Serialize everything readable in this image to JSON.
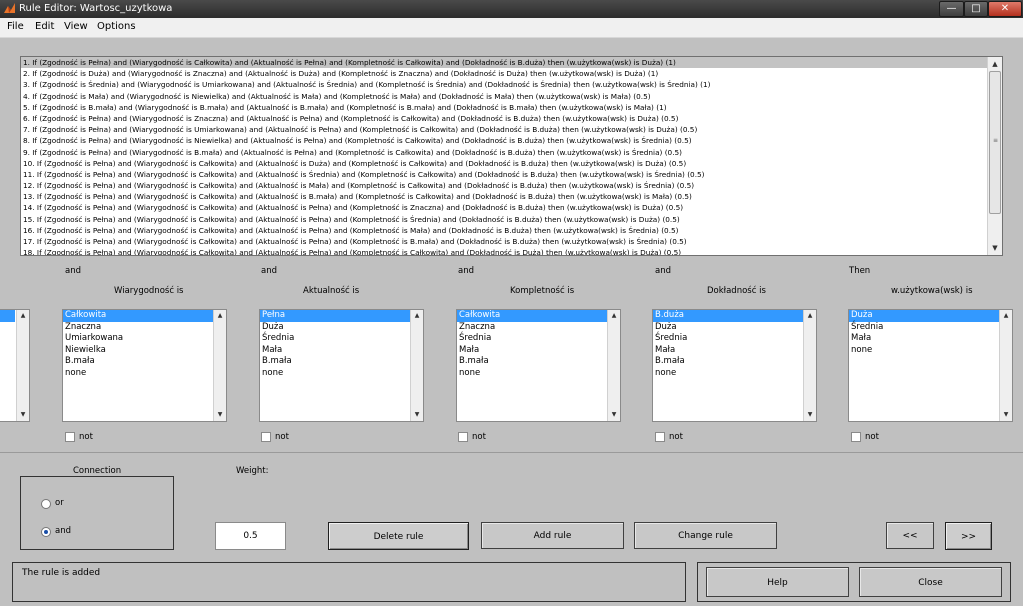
{
  "window": {
    "title": "Rule Editor: Wartosc_uzytkowa",
    "minimize": "—",
    "maximize": "□",
    "close": "✕"
  },
  "menu": [
    "File",
    "Edit",
    "View",
    "Options"
  ],
  "rules": [
    "1. If (Zgodność is Pełna) and (Wiarygodność is Całkowita) and (Aktualność is Pełna) and (Kompletność is Całkowita) and (Dokładność is B.duża) then (w.użytkowa(wsk) is Duża) (1)",
    "2. If (Zgodność is Duża) and (Wiarygodność is Znaczna) and (Aktualność is Duża) and (Kompletność is Znaczna) and (Dokładność is Duża) then (w.użytkowa(wsk) is Duża) (1)",
    "3. If (Zgodność is Średnia) and (Wiarygodność is Umiarkowana) and (Aktualność is Średnia) and (Kompletność is Średnia) and (Dokładność is Średnia) then (w.użytkowa(wsk) is Średnia) (1)",
    "4. If (Zgodność is Mała) and (Wiarygodność is Niewielka) and (Aktualność is Mała) and (Kompletność is Mała) and (Dokładność is Mała) then (w.użytkowa(wsk) is Mała) (0.5)",
    "5. If (Zgodność is B.mała) and (Wiarygodność is B.mała) and (Aktualność is B.mała) and (Kompletność is B.mała) and (Dokładność is B.mała) then (w.użytkowa(wsk) is Mała) (1)",
    "6. If (Zgodność is Pełna) and (Wiarygodność is Znaczna) and (Aktualność is Pełna) and (Kompletność is Całkowita) and (Dokładność is B.duża) then (w.użytkowa(wsk) is Duża) (0.5)",
    "7. If (Zgodność is Pełna) and (Wiarygodność is Umiarkowana) and (Aktualność is Pełna) and (Kompletność is Całkowita) and (Dokładność is B.duża) then (w.użytkowa(wsk) is Duża) (0.5)",
    "8. If (Zgodność is Pełna) and (Wiarygodność is Niewielka) and (Aktualność is Pełna) and (Kompletność is Całkowita) and (Dokładność is B.duża) then (w.użytkowa(wsk) is Średnia) (0.5)",
    "9. If (Zgodność is Pełna) and (Wiarygodność is B.mała) and (Aktualność is Pełna) and (Kompletność is Całkowita) and (Dokładność is B.duża) then (w.użytkowa(wsk) is Średnia) (0.5)",
    "10. If (Zgodność is Pełna) and (Wiarygodność is Całkowita) and (Aktualność is Duża) and (Kompletność is Całkowita) and (Dokładność is B.duża) then (w.użytkowa(wsk) is Duża) (0.5)",
    "11. If (Zgodność is Pełna) and (Wiarygodność is Całkowita) and (Aktualność is Średnia) and (Kompletność is Całkowita) and (Dokładność is B.duża) then (w.użytkowa(wsk) is Średnia) (0.5)",
    "12. If (Zgodność is Pełna) and (Wiarygodność is Całkowita) and (Aktualność is Mała) and (Kompletność is Całkowita) and (Dokładność is B.duża) then (w.użytkowa(wsk) is Średnia) (0.5)",
    "13. If (Zgodność is Pełna) and (Wiarygodność is Całkowita) and (Aktualność is B.mała) and (Kompletność is Całkowita) and (Dokładność is B.duża) then (w.użytkowa(wsk) is Mała) (0.5)",
    "14. If (Zgodność is Pełna) and (Wiarygodność is Całkowita) and (Aktualność is Pełna) and (Kompletność is Znaczna) and (Dokładność is B.duża) then (w.użytkowa(wsk) is Duża) (0.5)",
    "15. If (Zgodność is Pełna) and (Wiarygodność is Całkowita) and (Aktualność is Pełna) and (Kompletność is Średnia) and (Dokładność is B.duża) then (w.użytkowa(wsk) is Duża) (0.5)",
    "16. If (Zgodność is Pełna) and (Wiarygodność is Całkowita) and (Aktualność is Pełna) and (Kompletność is Mała) and (Dokładność is B.duża) then (w.użytkowa(wsk) is Średnia) (0.5)",
    "17. If (Zgodność is Pełna) and (Wiarygodność is Całkowita) and (Aktualność is Pełna) and (Kompletność is B.mała) and (Dokładność is B.duża) then (w.użytkowa(wsk) is Średnia) (0.5)",
    "18. If (Zgodność is Pełna) and (Wiarygodność is Całkowita) and (Aktualność is Pełna) and (Kompletność is Całkowita) and (Dokładność is Duża) then (w.użytkowa(wsk) is Duża) (0.5)"
  ],
  "selected_rule": 1,
  "columns": [
    {
      "connector": "and",
      "variable": "Wiarygodność is",
      "options": [
        "Całkowita",
        "Znaczna",
        "Umiarkowana",
        "Niewielka",
        "B.mała",
        "none"
      ],
      "selected": 0,
      "not_label": "not"
    },
    {
      "connector": "and",
      "variable": "Aktualność is",
      "options": [
        "Pełna",
        "Duża",
        "Średnia",
        "Mała",
        "B.mała",
        "none"
      ],
      "selected": 0,
      "not_label": "not"
    },
    {
      "connector": "and",
      "variable": "Kompletność is",
      "options": [
        "Całkowita",
        "Znaczna",
        "Średnia",
        "Mała",
        "B.mała",
        "none"
      ],
      "selected": 0,
      "not_label": "not"
    },
    {
      "connector": "and",
      "variable": "Dokładność is",
      "options": [
        "B.duża",
        "Duża",
        "Średnia",
        "Mała",
        "B.mała",
        "none"
      ],
      "selected": 0,
      "not_label": "not"
    },
    {
      "connector": "Then",
      "variable": "w.użytkowa(wsk) is",
      "options": [
        "Duża",
        "Średnia",
        "Mała",
        "none"
      ],
      "selected": 0,
      "not_label": "not"
    }
  ],
  "connection": {
    "title": "Connection",
    "or_label": "or",
    "and_label": "and",
    "selected": "and"
  },
  "weight": {
    "label": "Weight:",
    "value": "0.5"
  },
  "buttons": {
    "delete_rule": "Delete rule",
    "add_rule": "Add rule",
    "change_rule": "Change rule",
    "prev": "<<",
    "next": ">>",
    "help": "Help",
    "close": "Close"
  },
  "status": "The rule is added"
}
